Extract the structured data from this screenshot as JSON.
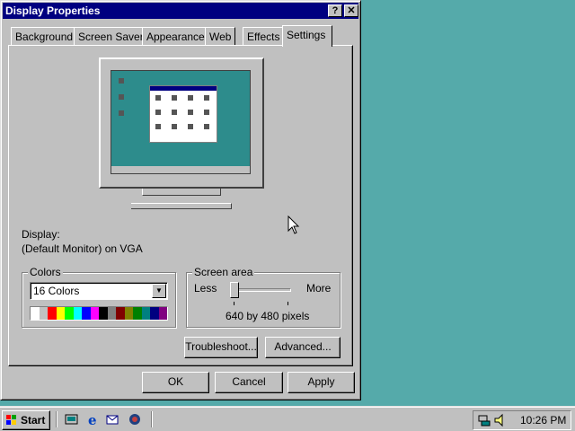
{
  "window": {
    "title": "Display Properties",
    "help_glyph": "?",
    "close_glyph": "✕"
  },
  "tabs": [
    {
      "label": "Background"
    },
    {
      "label": "Screen Saver"
    },
    {
      "label": "Appearance"
    },
    {
      "label": "Web"
    },
    {
      "label": "Effects"
    },
    {
      "label": "Settings",
      "active": true
    }
  ],
  "display": {
    "heading": "Display:",
    "value": "(Default Monitor) on VGA"
  },
  "colors": {
    "group_title": "Colors",
    "selected": "16 Colors",
    "dropdown_glyph": "▼",
    "palette": [
      "#FFFFFF",
      "#C0C0C0",
      "#FF0000",
      "#FFFF00",
      "#00FF00",
      "#00FFFF",
      "#0000FF",
      "#FF00FF",
      "#000000",
      "#808080",
      "#800000",
      "#808000",
      "#008000",
      "#008080",
      "#000080",
      "#800080"
    ]
  },
  "screen_area": {
    "group_title": "Screen area",
    "less_label": "Less",
    "more_label": "More",
    "resolution": "640 by 480 pixels",
    "slider_level": 0
  },
  "buttons": {
    "troubleshoot": "Troubleshoot...",
    "advanced": "Advanced...",
    "ok": "OK",
    "cancel": "Cancel",
    "apply": "Apply"
  },
  "taskbar": {
    "start_label": "Start",
    "clock": "10:26 PM",
    "quick_launch_icons": [
      "show-desktop-icon",
      "internet-explorer-icon",
      "outlook-express-icon",
      "channels-icon"
    ],
    "tray_icons": [
      "network-icon",
      "volume-icon"
    ]
  },
  "desktop_color": "#55AAAA"
}
